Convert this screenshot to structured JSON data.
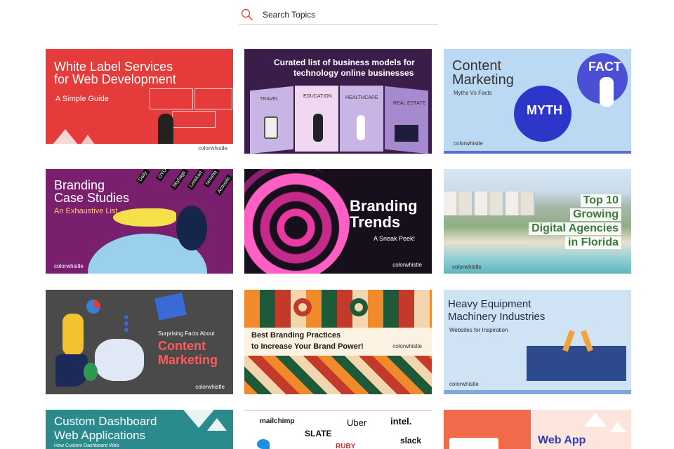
{
  "search": {
    "placeholder": "Search Topics"
  },
  "cards": [
    {
      "lines": [
        "White Label Services",
        "for Web Development"
      ],
      "sub": "A Simple Guide",
      "logo": "colorwhistle"
    },
    {
      "lines": [
        "Curated list of business models for",
        "technology online businesses"
      ],
      "tags": [
        "TRAVEL",
        "EDUCATION",
        "HEALTHCARE",
        "REAL ESTATE"
      ]
    },
    {
      "lines": [
        "Content",
        "Marketing"
      ],
      "sub": "Myths Vs Facts",
      "bubbles": [
        "FACT",
        "MYTH"
      ],
      "logo": "colorwhistle"
    },
    {
      "lines": [
        "Branding",
        "Case Studies"
      ],
      "sub": "An Exhaustive List",
      "brands": [
        "Daily",
        "OYO",
        "Skybags",
        "Lenskart",
        "tanishq",
        "Acoustic"
      ],
      "logo": "colorwhistle"
    },
    {
      "lines": [
        "Branding",
        "Trends"
      ],
      "sub": "A Sneak Peek!",
      "logo": "colorwhistle"
    },
    {
      "lines": [
        "Top 10",
        "Growing",
        "Digital Agencies",
        "in Florida"
      ],
      "logo": "colorwhistle"
    },
    {
      "lines": [
        "Content",
        "Marketing"
      ],
      "sub": "Surprising Facts About",
      "logo": "colorwhistle"
    },
    {
      "lines": [
        "Best Branding Practices",
        "to Increase Your Brand Power!"
      ],
      "logo": "colorwhistle"
    },
    {
      "lines": [
        "Heavy Equipment",
        "Machinery Industries"
      ],
      "sub": "Websites for Inspiration",
      "logo": "colorwhistle"
    },
    {
      "lines": [
        "Custom Dashboard",
        "Web Applications"
      ],
      "sub": "How Custom Dashboard Web"
    },
    {
      "brands": [
        "mailchimp",
        "Uber",
        "intel.",
        "SLATE",
        "slack",
        "RUBY"
      ]
    },
    {
      "lines": [
        "Web App"
      ]
    }
  ],
  "colors": {
    "red": "#e63b3b",
    "purple": "#3b1d4a",
    "lightblue": "#bcd9f4",
    "magenta": "#7a1f6e",
    "dark": "#17101c",
    "teal": "#2a8a8c",
    "navy": "#1f3a8a"
  }
}
